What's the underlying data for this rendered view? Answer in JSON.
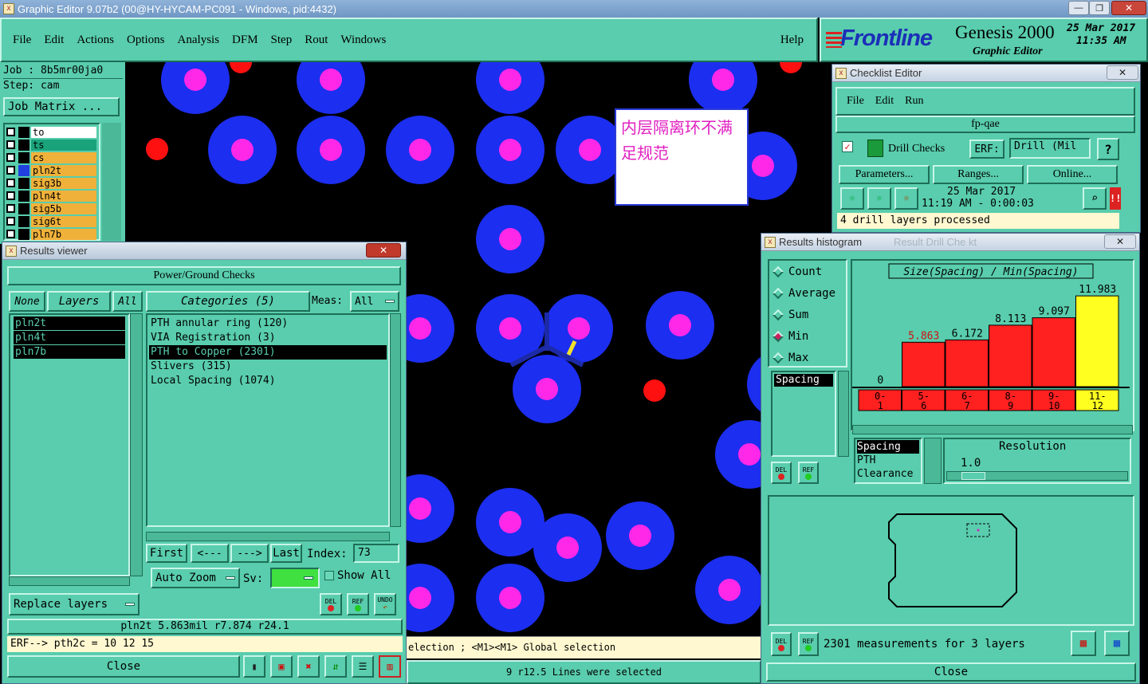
{
  "title_bar": {
    "title": "Graphic Editor 9.07b2 (00@HY-HYCAM-PC091 - Windows, pid:4432)",
    "minimize": "—",
    "restore": "❐",
    "close": "✕"
  },
  "menu": {
    "items": [
      "File",
      "Edit",
      "Actions",
      "Options",
      "Analysis",
      "DFM",
      "Step",
      "Rout",
      "Windows"
    ],
    "help": "Help"
  },
  "brand": {
    "logo": "Frontline",
    "product": "Genesis 2000",
    "subtitle": "Graphic Editor",
    "date": "25 Mar 2017",
    "time": "11:35 AM"
  },
  "job": {
    "job_label": "Job : 8b5mr00ja0",
    "step_label": "Step: cam",
    "matrix_button": "Job Matrix ..."
  },
  "layers": [
    {
      "name": "to",
      "color": "#ffffff"
    },
    {
      "name": "ts",
      "color": "#1aa37a"
    },
    {
      "name": "cs",
      "color": "#f0b13a"
    },
    {
      "name": "pln2t",
      "color": "#f0b13a"
    },
    {
      "name": "sig3b",
      "color": "#f0b13a"
    },
    {
      "name": "pln4t",
      "color": "#f0b13a"
    },
    {
      "name": "sig5b",
      "color": "#f0b13a"
    },
    {
      "name": "sig6t",
      "color": "#f0b13a"
    },
    {
      "name": "pln7b",
      "color": "#f0b13a"
    }
  ],
  "annotation": {
    "text": "内层隔离环不满足规范"
  },
  "results_viewer": {
    "title": "Results viewer",
    "section": "Power/Ground Checks",
    "none": "None",
    "layers": "Layers",
    "all": "All",
    "categories": "Categories (5)",
    "meas_label": "Meas:",
    "meas_value": "All",
    "layer_items": [
      "pln2t",
      "pln4t",
      "pln7b"
    ],
    "category_items": [
      "PTH annular ring (120)",
      "VIA Registration (3)",
      "PTH to Copper (2301)",
      "Slivers (315)",
      "Local Spacing (1074)"
    ],
    "first": "First",
    "prev": "<---",
    "next": "--->",
    "last": "Last",
    "index_label": "Index:",
    "index_value": "73",
    "auto_zoom": "Auto Zoom",
    "sv_label": "Sv:",
    "show_all": "Show All",
    "replace_layers": "Replace layers",
    "del": "DEL",
    "ref": "REF",
    "undo": "UNDO",
    "status": "pln2t 5.863mil  r7.874  r24.1",
    "erf": "ERF--> pth2c = 10 12 15",
    "close": "Close"
  },
  "checklist": {
    "title": "Checklist Editor",
    "menu": [
      "File",
      "Edit",
      "Run"
    ],
    "name": "fp-qae",
    "check": "Drill Checks",
    "erf_label": "ERF:",
    "erf_value": "Drill (Mil",
    "help": "?",
    "parameters": "Parameters...",
    "ranges": "Ranges...",
    "online": "Online...",
    "date": "25 Mar 2017",
    "time": "11:19 AM - 0:00:03",
    "status": "4 drill layers processed"
  },
  "histogram": {
    "title": "Results histogram",
    "ghost_title": "Result Drill Che kt",
    "modes": [
      "Count",
      "Average",
      "Sum",
      "Min",
      "Max"
    ],
    "selected_mode": "Min",
    "heading": "Size(Spacing) / Min(Spacing)",
    "list_item": "Spacing",
    "del": "DEL",
    "ref": "REF",
    "measure_items": [
      "Spacing",
      "PTH",
      "Clearance"
    ],
    "resolution_label": "Resolution",
    "resolution_value": "1.0",
    "summary": "2301 measurements for 3 layers",
    "close": "Close"
  },
  "chart_data": {
    "type": "bar",
    "title": "Size(Spacing) / Min(Spacing)",
    "categories": [
      "0-1",
      "5-6",
      "6-7",
      "8-9",
      "9-10",
      "11-12"
    ],
    "values": [
      0,
      5.863,
      6.172,
      8.113,
      9.097,
      11.983
    ],
    "value_labels": [
      "0",
      "5.863",
      "6.172",
      "8.113",
      "9.097",
      "11.983"
    ],
    "colors": [
      "#ff2020",
      "#ff2020",
      "#ff2020",
      "#ff2020",
      "#ff2020",
      "#ffff20"
    ],
    "ylim": [
      0,
      12
    ]
  },
  "canvas": {
    "prompt": "election ; <M1><M1> Global selection",
    "status": "9 r12.5 Lines were selected"
  }
}
